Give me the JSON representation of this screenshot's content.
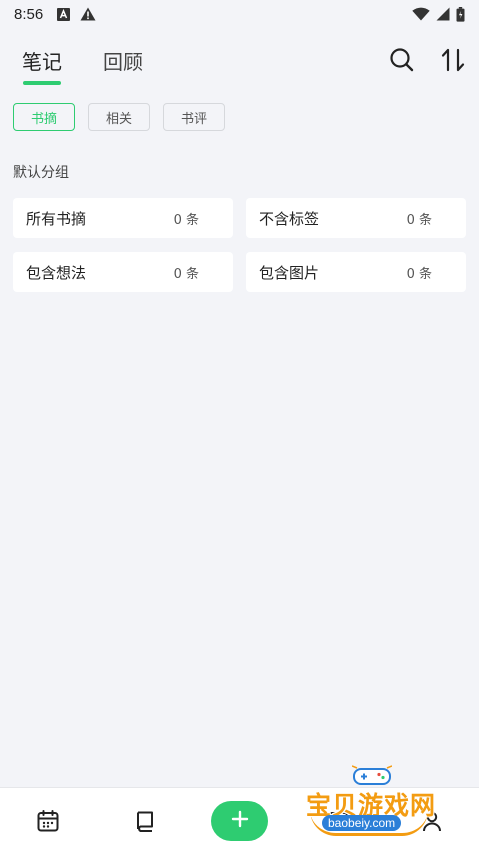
{
  "status_bar": {
    "time": "8:56",
    "left_icons": [
      "font-a-icon",
      "warning-icon"
    ],
    "right_icons": [
      "wifi-icon",
      "signal-icon",
      "battery-icon"
    ]
  },
  "header": {
    "tabs": [
      {
        "label": "笔记",
        "active": true
      },
      {
        "label": "回顾",
        "active": false
      }
    ],
    "actions": [
      "search-icon",
      "sort-icon"
    ]
  },
  "filters": [
    {
      "label": "书摘",
      "active": true
    },
    {
      "label": "相关",
      "active": false
    },
    {
      "label": "书评",
      "active": false
    }
  ],
  "section": {
    "title": "默认分组"
  },
  "groups": [
    {
      "label": "所有书摘",
      "count": "0 条"
    },
    {
      "label": "不含标签",
      "count": "0 条"
    },
    {
      "label": "包含想法",
      "count": "0 条"
    },
    {
      "label": "包含图片",
      "count": "0 条"
    }
  ],
  "bottom_nav": {
    "items": [
      "calendar-icon",
      "book-icon",
      "add-icon",
      "ideas-icon",
      "profile-icon"
    ]
  },
  "watermark": {
    "title": "宝贝游戏网",
    "url": "baobeiy.com"
  },
  "colors": {
    "accent": "#2ecc71",
    "background": "#f3f4f8",
    "card": "#ffffff"
  }
}
